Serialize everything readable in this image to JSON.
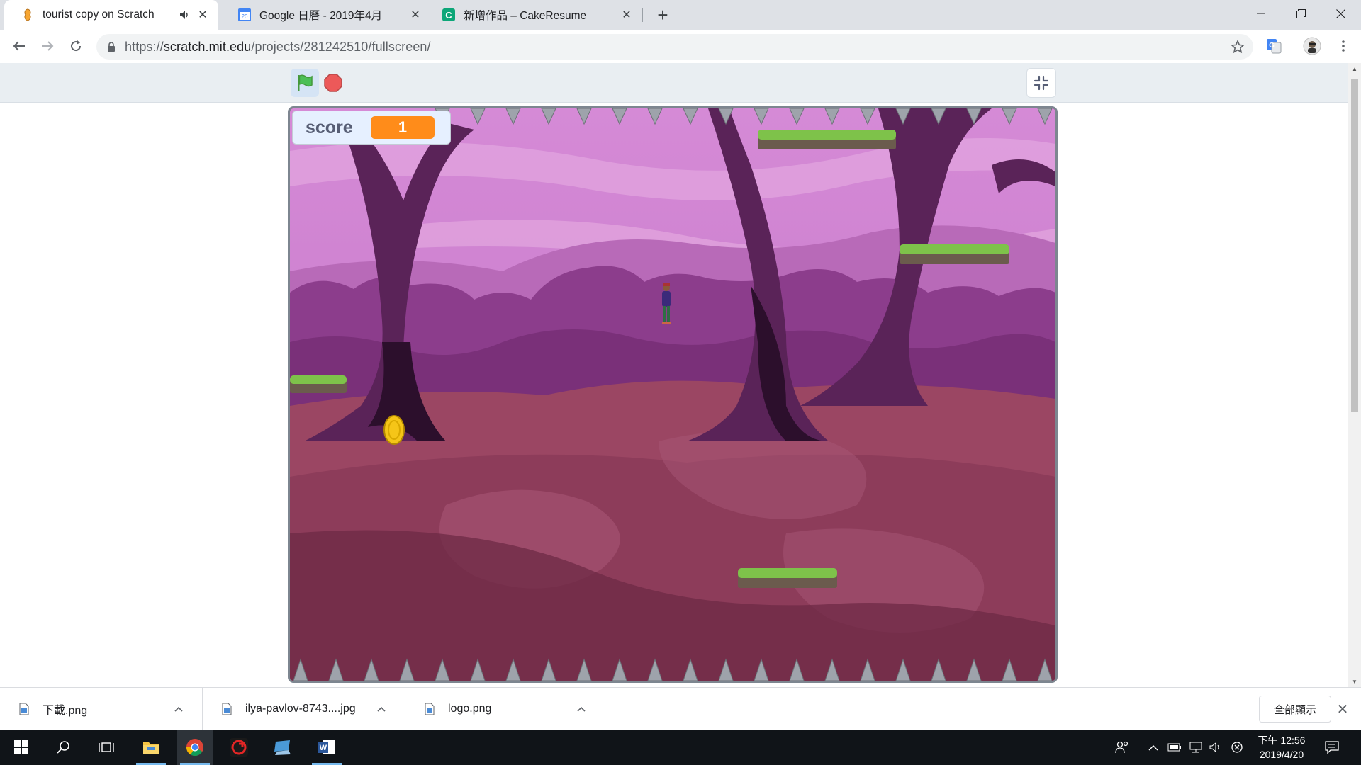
{
  "browser": {
    "tabs": [
      {
        "title": "tourist copy on Scratch",
        "favicon": "scratch-cat-icon",
        "active": true,
        "audio": true
      },
      {
        "title": "Google 日曆 - 2019年4月",
        "favicon": "google-calendar-icon",
        "favicon_text": "20",
        "active": false
      },
      {
        "title": "新增作品 – CakeResume",
        "favicon": "cakeresume-icon",
        "active": false
      }
    ],
    "url": {
      "scheme": "https://",
      "host": "scratch.mit.edu",
      "path": "/projects/281242510/fullscreen/"
    }
  },
  "scratch": {
    "monitor": {
      "label": "score",
      "value": "1"
    },
    "colors": {
      "accent": "#ff8c1a",
      "stage_bg": "#8a3d5a",
      "sky": "#c97ad0"
    }
  },
  "downloads": {
    "items": [
      {
        "name": "下載.png"
      },
      {
        "name": "ilya-pavlov-8743....jpg"
      },
      {
        "name": "logo.png"
      }
    ],
    "show_all": "全部顯示"
  },
  "taskbar": {
    "clock_time": "下午 12:56",
    "clock_date": "2019/4/20"
  }
}
